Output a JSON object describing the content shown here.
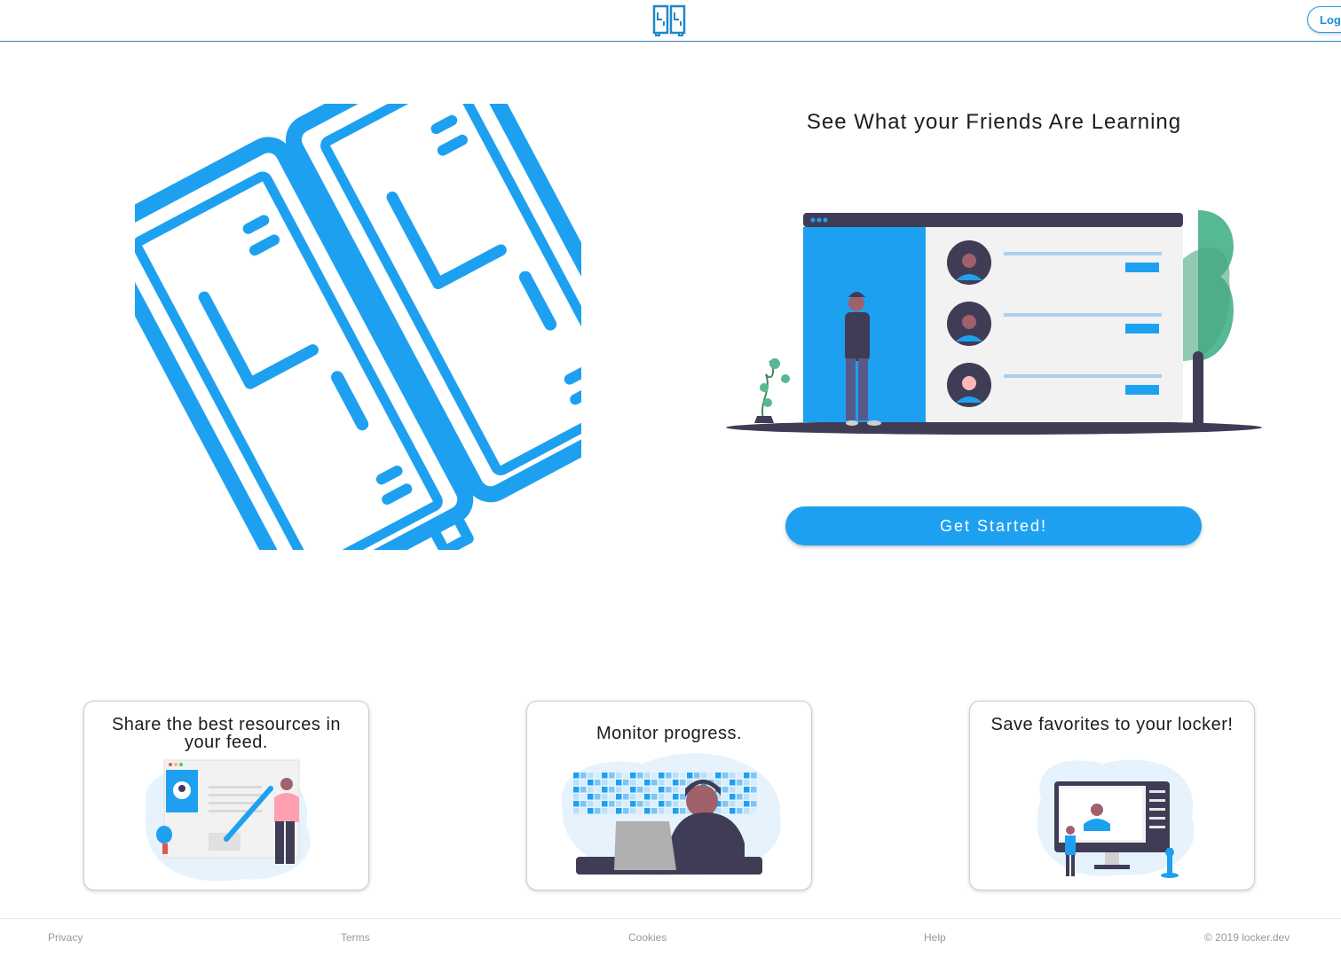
{
  "header": {
    "logo_icon": "locker-icon",
    "login_label": "Login"
  },
  "hero": {
    "title": "See What your Friends Are Learning",
    "cta_label": "Get Started!"
  },
  "features": [
    {
      "title": "Share the best resources in your feed.",
      "illustration": "share-resources-illustration"
    },
    {
      "title": "Monitor progress.",
      "illustration": "monitor-progress-illustration"
    },
    {
      "title": "Save favorites to your locker!",
      "illustration": "save-favorites-illustration"
    }
  ],
  "footer": {
    "links": [
      "Privacy",
      "Terms",
      "Cookies",
      "Help"
    ],
    "copyright": "© 2019 locker.dev"
  },
  "colors": {
    "accent": "#1ea0f0",
    "dark": "#3f3d56",
    "tree_green": "#57b894",
    "rule": "#2a7fb8"
  }
}
